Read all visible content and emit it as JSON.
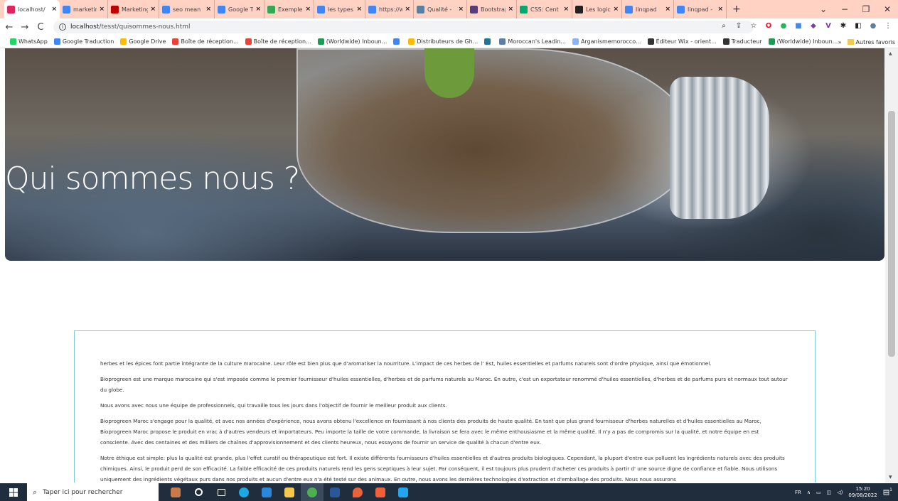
{
  "browser": {
    "tabs": [
      {
        "title": "localhost/",
        "icon": "localhost-tab-icon",
        "color": "#e0245e",
        "active": true
      },
      {
        "title": "marketing",
        "icon": "google-icon",
        "color": "#4285f4"
      },
      {
        "title": "Marketing",
        "icon": "marketing-site-icon",
        "color": "#c00000"
      },
      {
        "title": "seo mean",
        "icon": "google-icon",
        "color": "#4285f4"
      },
      {
        "title": "Google Tr",
        "icon": "google-translate-icon",
        "color": "#4285f4"
      },
      {
        "title": "Exemple",
        "icon": "exemple-icon",
        "color": "#34a853"
      },
      {
        "title": "les types",
        "icon": "google-icon",
        "color": "#4285f4"
      },
      {
        "title": "https://w",
        "icon": "google-icon",
        "color": "#4285f4"
      },
      {
        "title": "Qualité -",
        "icon": "qualite-icon",
        "color": "#5f7f9f"
      },
      {
        "title": "Bootstrap",
        "icon": "bootstrap-icon",
        "color": "#563d7c"
      },
      {
        "title": "CSS: Cent",
        "icon": "w3schools-icon",
        "color": "#04aa6d"
      },
      {
        "title": "Les logici",
        "icon": "logiciel-icon",
        "color": "#222222"
      },
      {
        "title": "linqpad",
        "icon": "google-icon",
        "color": "#4285f4"
      },
      {
        "title": "linqpad -",
        "icon": "google-icon",
        "color": "#4285f4"
      }
    ],
    "close_glyph": "×",
    "new_tab_glyph": "+",
    "url_host": "localhost",
    "url_path": "/tesst/quisommes-nous.html",
    "bookmarks": [
      {
        "label": "WhatsApp",
        "icon": "whatsapp-icon",
        "color": "#25d366"
      },
      {
        "label": "Google Traduction",
        "icon": "google-translate-icon",
        "color": "#4285f4"
      },
      {
        "label": "Google Drive",
        "icon": "google-drive-icon",
        "color": "#fbbc04"
      },
      {
        "label": "Boîte de réception...",
        "icon": "gmail-icon",
        "color": "#ea4335"
      },
      {
        "label": "Boîte de réception...",
        "icon": "gmail-icon",
        "color": "#ea4335"
      },
      {
        "label": "(Worldwide) Inboun...",
        "icon": "inbound-icon",
        "color": "#1a9c55"
      },
      {
        "label": "",
        "icon": "docs-icon",
        "color": "#4285f4"
      },
      {
        "label": "Distributeurs de Gh...",
        "icon": "distributeurs-icon",
        "color": "#fbbc04"
      },
      {
        "label": "",
        "icon": "wordpress-icon",
        "color": "#21759b"
      },
      {
        "label": "Moroccan's Leadin...",
        "icon": "moroccan-icon",
        "color": "#5f7f9f"
      },
      {
        "label": "Arganismemorocco...",
        "icon": "argan-icon",
        "color": "#8ab4f8"
      },
      {
        "label": "Éditeur Wix - orient...",
        "icon": "wix-icon",
        "color": "#333333"
      },
      {
        "label": "Traducteur",
        "icon": "translator-icon",
        "color": "#333333"
      },
      {
        "label": "(Worldwide) Inboun...",
        "icon": "inbound-icon",
        "color": "#1a9c55"
      }
    ],
    "bookmarks_more": "»",
    "other_bookmarks": "Autres favoris"
  },
  "page": {
    "hero_title": "Qui sommes nous ?",
    "paragraphs": [
      "herbes et les épices font partie intégrante de la culture marocaine. Leur rôle est bien plus que d'aromatiser la nourriture. L'impact de ces herbes de l' Est, huiles essentielles et parfums naturels sont d'ordre physique, ainsi que émotionnel.",
      "Bioprogreen est une marque marocaine qui s'est imposée comme le premier fournisseur d'huiles essentielles, d'herbes et de parfums naturels au Maroc. En outre, c'est un exportateur renommé d'huiles essentielles, d'herbes et de parfums purs et normaux tout autour du globe.",
      "Nous avons avec nous une équipe de professionnels, qui travaille tous les jours dans l'objectif de fournir le meilleur produit aux clients.",
      "Bioprogreen Maroc s'engage pour la qualité, et avec nos années d'expérience, nous avons obtenu l'excellence en fournissant à nos clients des produits de haute qualité. En tant que plus grand fournisseur d'herbes naturelles et d'huiles essentielles au Maroc, Bioprogreen Maroc propose le produit en vrac à d'autres vendeurs et importateurs. Peu importe la taille de votre commande, la livraison se fera avec le même enthousiasme et la même qualité. Il n'y a pas de compromis sur la qualité, et notre équipe en est consciente. Avec des centaines et des milliers de chaînes d'approvisionnement et des clients heureux, nous essayons de fournir un service de qualité à chacun d'entre eux.",
      "Notre éthique est simple: plus la qualité est grande, plus l'effet curatif ou thérapeutique est fort. Il existe différents fournisseurs d'huiles essentielles et d'autres produits biologiques. Cependant, la plupart d'entre eux polluent les ingrédients naturels avec des produits chimiques. Ainsi, le produit perd de son efficacité. La faible efficacité de ces produits naturels rend les gens sceptiques à leur sujet. Par conséquent, il est toujours plus prudent d'acheter ces produits à partir d' une source digne de confiance et fiable. Nous utilisons uniquement des ingrédients végétaux purs dans nos produits et aucun d'entre eux n'a été testé sur des animaux. En outre, nous avons les dernières technologies d'extraction et d'emballage des produits. Nous nous assurons"
    ]
  },
  "taskbar": {
    "search_placeholder": "Taper ici pour rechercher",
    "language": "FR",
    "time": "15:20",
    "date": "09/08/2022",
    "notification_count": "1"
  }
}
